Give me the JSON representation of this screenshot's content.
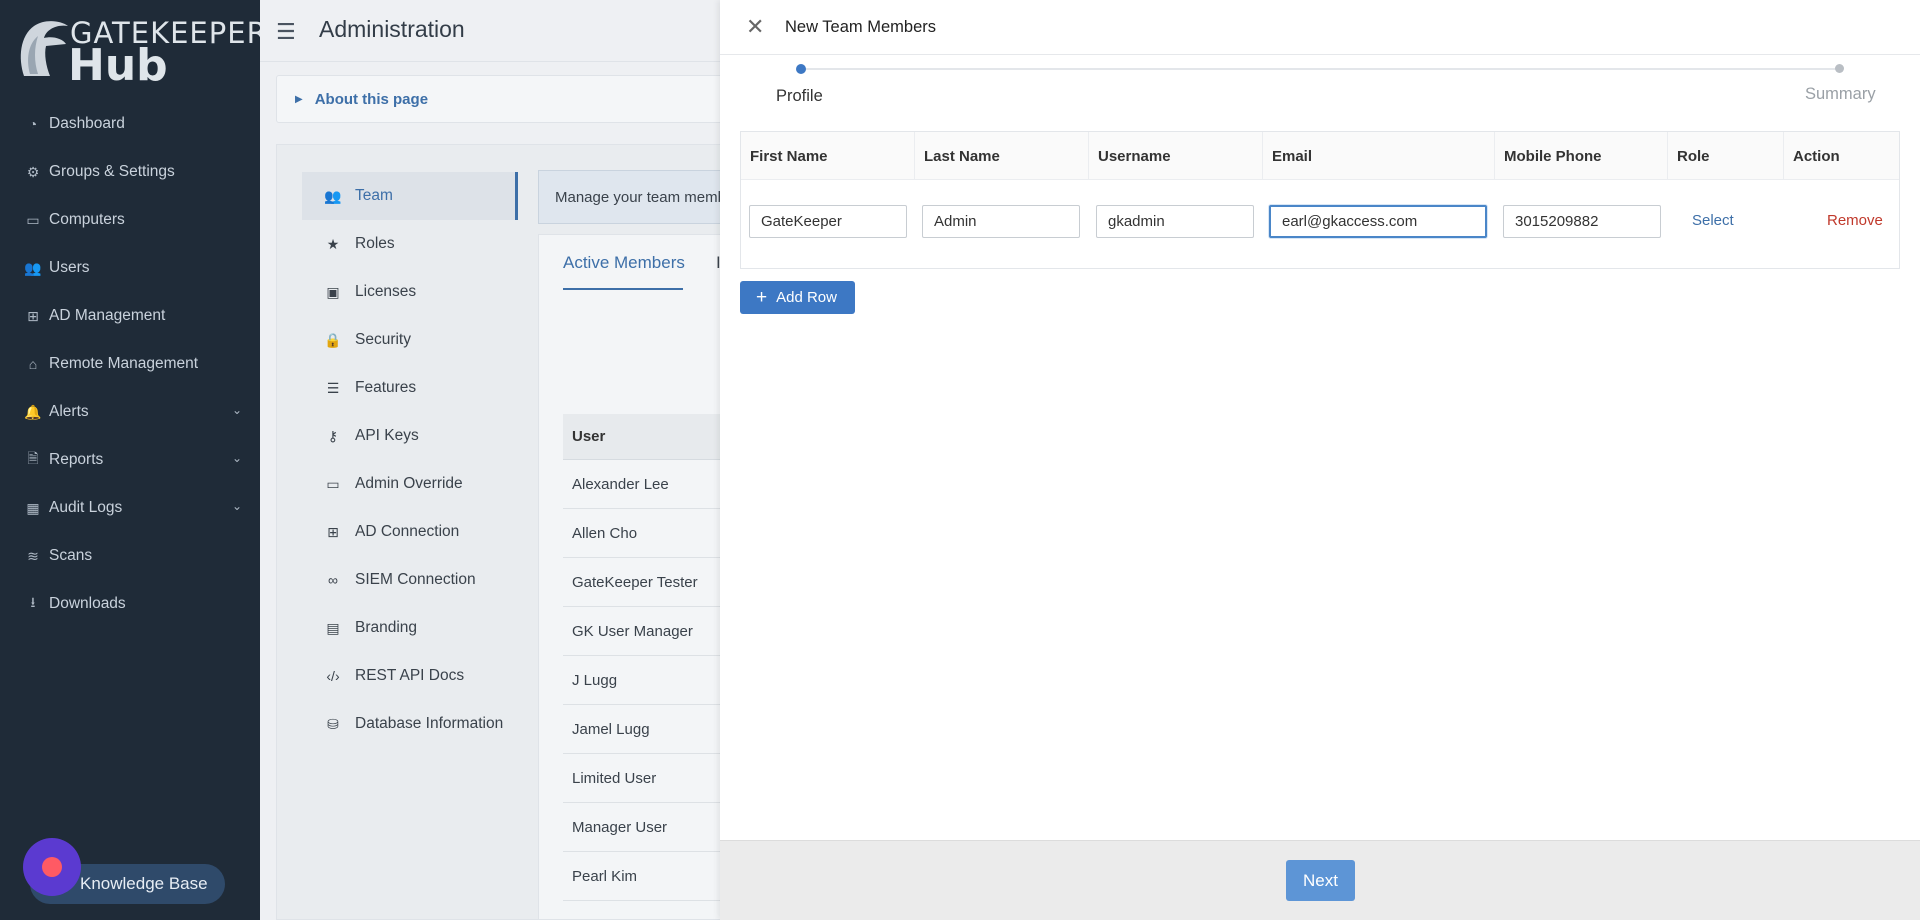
{
  "app": {
    "brand_top": "GATEKEEPER",
    "brand_bottom": "Hub"
  },
  "sidebar": {
    "items": [
      {
        "label": "Dashboard",
        "icon": "dashboard-icon"
      },
      {
        "label": "Groups & Settings",
        "icon": "gears-icon"
      },
      {
        "label": "Computers",
        "icon": "laptop-icon"
      },
      {
        "label": "Users",
        "icon": "users-icon"
      },
      {
        "label": "AD Management",
        "icon": "windows-icon"
      },
      {
        "label": "Remote Management",
        "icon": "dome-icon"
      },
      {
        "label": "Alerts",
        "icon": "bell-icon",
        "expandable": true
      },
      {
        "label": "Reports",
        "icon": "file-icon",
        "expandable": true
      },
      {
        "label": "Audit Logs",
        "icon": "table-icon",
        "expandable": true
      },
      {
        "label": "Scans",
        "icon": "wifi-icon"
      },
      {
        "label": "Downloads",
        "icon": "download-icon"
      }
    ],
    "knowledge_base": "Knowledge Base"
  },
  "header": {
    "title": "Administration",
    "about": "About this page"
  },
  "submenu": {
    "items": [
      {
        "label": "Team",
        "icon": "users-icon",
        "active": true
      },
      {
        "label": "Roles",
        "icon": "star-icon"
      },
      {
        "label": "Licenses",
        "icon": "book-icon"
      },
      {
        "label": "Security",
        "icon": "lock-icon"
      },
      {
        "label": "Features",
        "icon": "list-icon"
      },
      {
        "label": "API Keys",
        "icon": "key-icon"
      },
      {
        "label": "Admin Override",
        "icon": "monitor-icon"
      },
      {
        "label": "AD Connection",
        "icon": "windows-icon"
      },
      {
        "label": "SIEM Connection",
        "icon": "link-icon"
      },
      {
        "label": "Branding",
        "icon": "images-icon"
      },
      {
        "label": "REST API Docs",
        "icon": "code-icon"
      },
      {
        "label": "Database Information",
        "icon": "database-icon"
      }
    ]
  },
  "team": {
    "manage_text": "Manage your team memb",
    "tabs": [
      "Active Members",
      "I"
    ],
    "users_header": "User",
    "users": [
      "Alexander Lee",
      "Allen Cho",
      "GateKeeper Tester",
      "GK User Manager",
      "J Lugg",
      "Jamel Lugg",
      "Limited User",
      "Manager User",
      "Pearl Kim"
    ]
  },
  "drawer": {
    "title": "New Team Members",
    "steps": [
      "Profile",
      "Summary"
    ],
    "columns": [
      "First Name",
      "Last Name",
      "Username",
      "Email",
      "Mobile Phone",
      "Role",
      "Action"
    ],
    "row": {
      "first_name": "GateKeeper",
      "last_name": "Admin",
      "username": "gkadmin",
      "email": "earl@gkaccess.com",
      "mobile": "3015209882",
      "role_link": "Select",
      "action_link": "Remove"
    },
    "add_row": "Add Row",
    "next": "Next"
  },
  "colors": {
    "sidebar_bg": "#1f2b38",
    "accent": "#3d78c4",
    "remove": "#c0392b"
  }
}
